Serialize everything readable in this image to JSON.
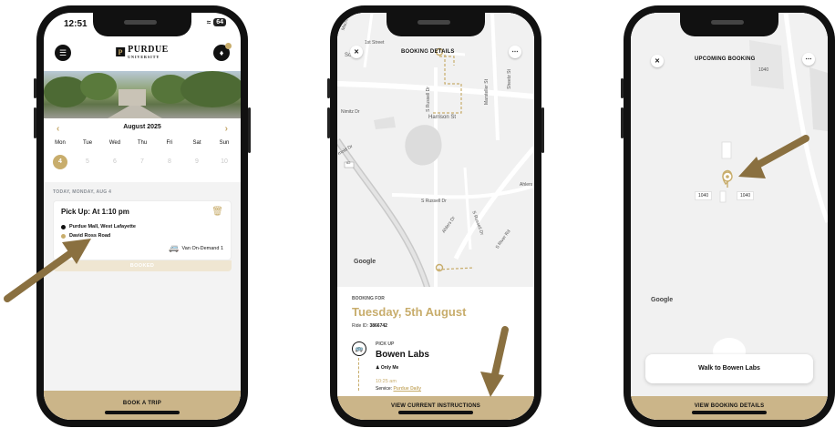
{
  "phone1": {
    "status": {
      "time": "12:51",
      "battery": "64"
    },
    "header": {
      "logo_text": "PURDUE",
      "logo_sub": "UNIVERSITY"
    },
    "calendar": {
      "month": "August 2025",
      "weekdays": [
        "Mon",
        "Tue",
        "Wed",
        "Thu",
        "Fri",
        "Sat",
        "Sun"
      ],
      "dates": [
        "4",
        "5",
        "6",
        "7",
        "8",
        "9",
        "10"
      ],
      "selected": "4"
    },
    "day_label": "TODAY, MONDAY, AUG 4",
    "trip": {
      "title": "Pick Up: At 1:10 pm",
      "from": "Purdue Mall, West Lafayette",
      "to": "David Ross Road",
      "vehicle": "Van On-Demand 1",
      "status": "BOOKED"
    },
    "cta": "BOOK A TRIP"
  },
  "phone2": {
    "title": "BOOKING DETAILS",
    "map_labels": {
      "street_top": "1st Street",
      "sheetz": "Sheetz St",
      "marsteller": "Marsteller St",
      "russell1": "S Russell Dr",
      "harrison": "Harrison St",
      "himitz": "Nimitz Dr",
      "russell2": "S Russell Dr",
      "ahlers": "Ahlers Dr",
      "ahlers2": "Ahlers",
      "russell3": "S Russell Dr",
      "river": "S River Rd",
      "machi": "Machi",
      "sw": "Sc",
      "arnold": "rnold Dr",
      "shield": "62"
    },
    "google": "Google",
    "booking_for_label": "BOOKING FOR",
    "date": "Tuesday, 5th August",
    "ride_label": "Ride ID:",
    "ride_id": "3866742",
    "pickup_label": "PICK UP",
    "pickup_place": "Bowen Labs",
    "pickup_who": "Only Me",
    "pickup_time": "10:25 am",
    "service_label": "Service:",
    "service_value": "Purdue Daily",
    "cta": "VIEW CURRENT INSTRUCTIONS"
  },
  "phone3": {
    "title": "UPCOMING BOOKING",
    "bldg_top": "1040",
    "bldg_left": "1040",
    "bldg_right": "1040",
    "google": "Google",
    "walk": "Walk to Bowen Labs",
    "cta": "VIEW BOOKING DETAILS"
  },
  "colors": {
    "gold": "#c8ad6c",
    "bar_gold": "#cbb589",
    "arrow": "#8a7040",
    "map_bg": "#f1f1f1"
  },
  "icons": [
    "menu-icon",
    "bell-icon",
    "trash-icon",
    "van-icon",
    "close-icon",
    "more-icon",
    "bus-icon",
    "person-icon",
    "location-pin-icon",
    "chevron-left-icon",
    "chevron-right-icon"
  ]
}
